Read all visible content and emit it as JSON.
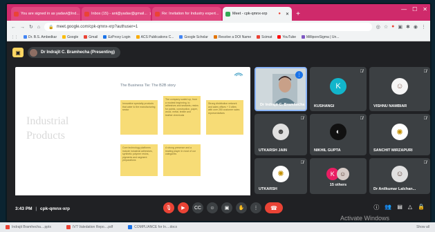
{
  "browser": {
    "tabs": [
      {
        "label": "You are signed in as yadavi@Ind...",
        "fav": "#ea4335",
        "active": false
      },
      {
        "label": "Inbox (15) - ant@yadav@gmail...",
        "fav": "#ea4335",
        "active": false
      },
      {
        "label": "Re: Invitation for Industry expert...",
        "fav": "#ea4335",
        "active": false
      },
      {
        "label": "Meet - cpk-qmnx-xrp",
        "fav": "#34a853",
        "active": true
      }
    ],
    "new_tab": "+",
    "url": "meet.google.com/cpk-qmnx-xrp?authuser=1",
    "bookmarks": [
      {
        "label": "Dr. B.S. Ambedkar",
        "color": "#4285f4"
      },
      {
        "label": "Google",
        "color": "#fbbc05"
      },
      {
        "label": "Gmail",
        "color": "#ea4335"
      },
      {
        "label": "EzProxy Login",
        "color": "#1a73e8"
      },
      {
        "label": "ACS Publications C...",
        "color": "#f9ab00"
      },
      {
        "label": "Google Scholar",
        "color": "#4285f4"
      },
      {
        "label": "Resolve a DOI Name",
        "color": "#e37400"
      },
      {
        "label": "Scimat",
        "color": "#ea4335"
      },
      {
        "label": "YouTube",
        "color": "#ff0000"
      },
      {
        "label": "MilliporeSigma | Un...",
        "color": "#7e57c2"
      }
    ]
  },
  "meet": {
    "presenter": "Dr Indrajit C. Bramhecha (Presenting)",
    "slide": {
      "title": "The Business Tie: The B2B story",
      "big_text_line1": "Industrial",
      "big_text_line2": "Products",
      "boxes": [
        "Innovative specialty products that cater to the manufacturing sector",
        "The company scaled up, from a modest beginning, to adhesives and sealants, resins for paints, construction, paper, wood, metal, textile and leather chemicals",
        "Strong distribution network and sales offices + 3 cities with over 250 customer sales representatives",
        "Core technology platforms include industrial adhesives, synthetic polymer resins, pigments and segment preparations",
        "A strong presence and a leading player in most of our categories"
      ]
    },
    "participants": [
      {
        "name": "Dr Indrajit C. Bramhecha",
        "type": "video"
      },
      {
        "name": "KUSHANGI",
        "initial": "K",
        "color": "#12b5cb"
      },
      {
        "name": "VISHNU NAMBIAR",
        "type": "photo"
      },
      {
        "name": "UTKARSH JAIN",
        "type": "photo"
      },
      {
        "name": "NIKHIL GUPTA",
        "type": "photo"
      },
      {
        "name": "SANCHIT MIRZAPURI",
        "type": "photo"
      },
      {
        "name": "UTKARSH",
        "type": "photo"
      },
      {
        "name": "15 others",
        "initial": "K",
        "color": "#e91e63"
      },
      {
        "name": "Dr Anilkumar Lalchan...",
        "type": "photo"
      }
    ],
    "time": "3:43 PM",
    "meeting_code": "cpk-qmnx-xrp",
    "watermark": "Activate Windows"
  },
  "downloads": [
    "Indrajit Bramhecha....pptx",
    "IVT Valedation Repo....pdf",
    "COMPLIANCE for In....docx"
  ],
  "show_all": "Show all"
}
